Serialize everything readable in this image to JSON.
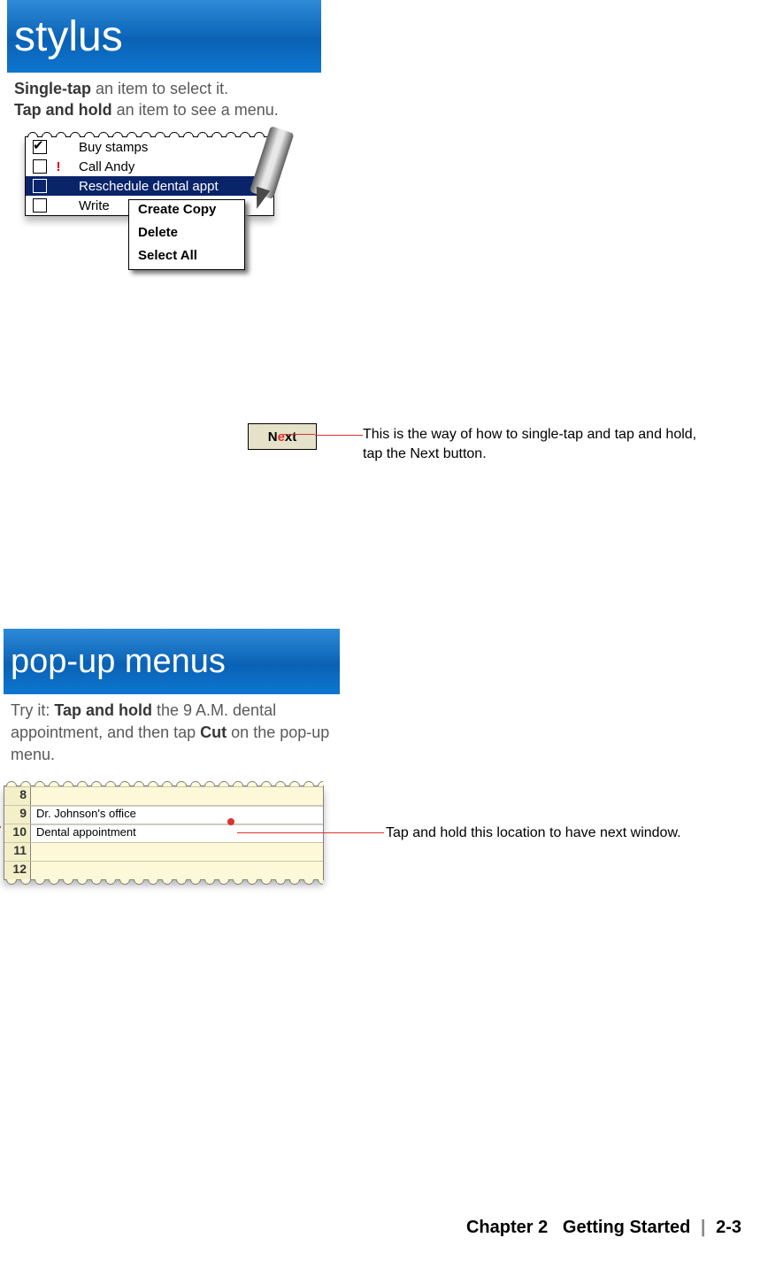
{
  "fig1": {
    "banner": "stylus",
    "caption_parts": {
      "bold1": "Single-tap",
      "t1": " an item to select it.",
      "bold2": "Tap and hold",
      "t2": " an item to see a menu."
    },
    "tasks": [
      {
        "checked": true,
        "priority": "",
        "selected": false,
        "text": "Buy stamps"
      },
      {
        "checked": false,
        "priority": "!",
        "selected": false,
        "text": "Call Andy"
      },
      {
        "checked": false,
        "priority": "",
        "selected": true,
        "text": "Reschedule dental appt"
      },
      {
        "checked": false,
        "priority": "",
        "selected": false,
        "text": "Write"
      }
    ],
    "context_menu": [
      "Create Copy",
      "Delete",
      "Select All"
    ]
  },
  "next": {
    "label_pre": "N",
    "label_post": "xt",
    "annotation": "This is the way of how to single-tap and tap and hold, tap the Next button."
  },
  "fig2": {
    "banner": "pop-up menus",
    "caption_parts": {
      "t0": "Try it: ",
      "bold1": "Tap and hold",
      "t1": " the 9 A.M. dental appointment, and then tap ",
      "bold2": "Cut",
      "t2": " on the pop-up menu."
    },
    "calendar": [
      {
        "hour": "8",
        "text": ""
      },
      {
        "hour": "9",
        "text": "Dr. Johnson's office"
      },
      {
        "hour": "10",
        "text": "Dental appointment"
      },
      {
        "hour": "11",
        "text": ""
      },
      {
        "hour": "12",
        "text": ""
      }
    ],
    "annotation": "Tap and hold this location to have next window."
  },
  "footer": {
    "chapter": "Chapter 2",
    "title": "Getting Started",
    "page": "2-3"
  }
}
